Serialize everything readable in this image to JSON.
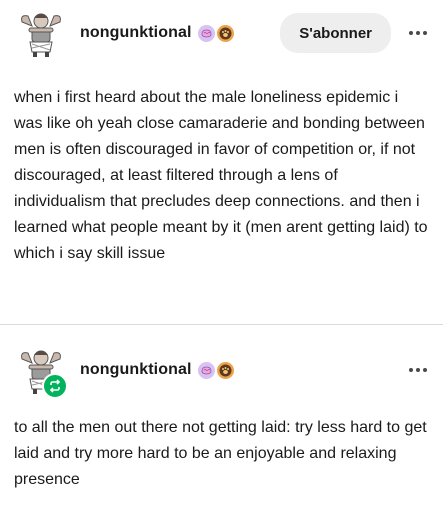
{
  "posts": [
    {
      "username": "nongunktional",
      "badges": [
        "brain-badge",
        "paw-badge"
      ],
      "follow_label": "S'abonner",
      "body": "when i first heard about the male loneliness epidemic i was like oh yeah close camaraderie and bonding between men is often discouraged in favor of competition or, if not discouraged, at least filtered through a lens of individualism that precludes deep connections. and then i learned what people meant by it (men arent getting laid) to which i say skill issue"
    },
    {
      "username": "nongunktional",
      "badges": [
        "brain-badge",
        "paw-badge"
      ],
      "body": "to all the men out there not getting laid: try less hard to get laid and try more hard to be an enjoyable and relaxing presence"
    }
  ],
  "colors": {
    "reblog_green": "#00b35c",
    "follow_bg": "#eeeeee",
    "divider": "#d9d9d9"
  },
  "icons": [
    "avatar-image",
    "brain-badge-icon",
    "paw-badge-icon",
    "more-options-icon",
    "reblog-icon"
  ]
}
